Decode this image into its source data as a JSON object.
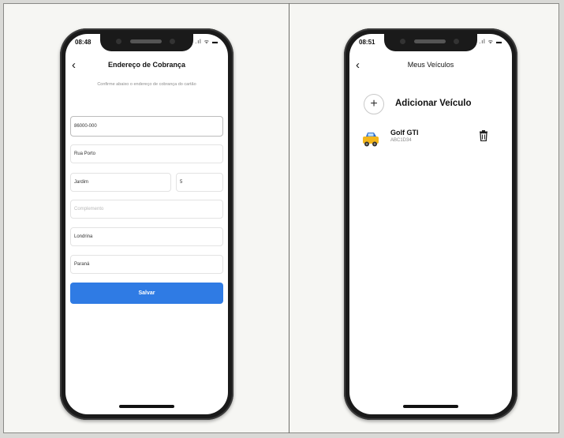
{
  "left_phone": {
    "status_time": "08:48",
    "status_icons": ".ıl ᯤ ▬",
    "title": "Endereço de Cobrança",
    "subtitle": "Confirme abaixo o endereço de cobrança do cartão",
    "fields": {
      "cep": "86000-000",
      "street": "Rua Porto",
      "neighborhood": "Jardim",
      "number": "5",
      "complement": "Complemento",
      "city": "Londrina",
      "state": "Paraná"
    },
    "save_label": "Salvar"
  },
  "right_phone": {
    "status_time": "08:51",
    "status_icons": ".ıl ᯤ ▬",
    "title": "Meus Veículos",
    "add_label": "Adicionar Veículo",
    "vehicle": {
      "name": "Golf GTI",
      "plate": "ABC1D34"
    }
  },
  "icons": {
    "back": "chevron-left-icon",
    "plus": "plus-icon",
    "car": "car-icon",
    "trash": "trash-icon"
  },
  "colors": {
    "accent": "#2f7be4",
    "car_body": "#f2b61c"
  }
}
